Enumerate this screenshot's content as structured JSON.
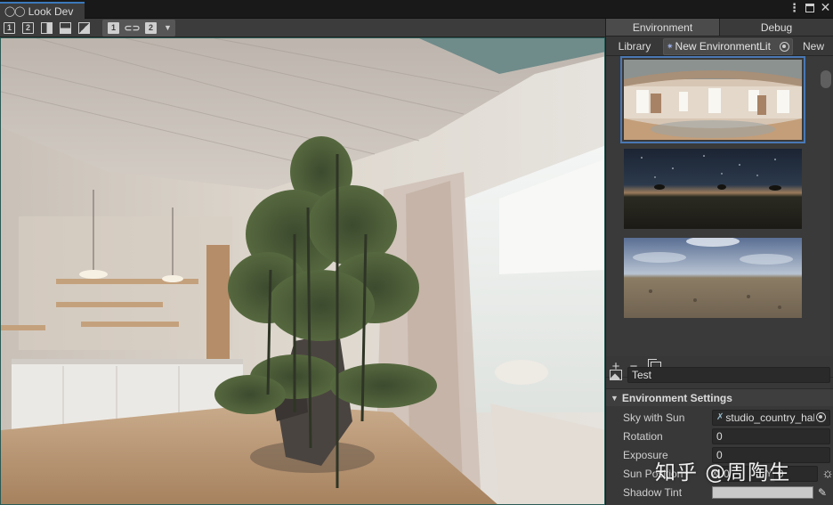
{
  "window": {
    "tab_title": "Look Dev",
    "controls": [
      "kebab-icon",
      "maximize-icon",
      "close-icon"
    ]
  },
  "toolbar": {
    "view_single_1": "1",
    "view_single_2": "2",
    "compare_1": "1",
    "compare_2": "2"
  },
  "side_panel": {
    "tabs": [
      {
        "label": "Environment",
        "active": true
      },
      {
        "label": "Debug",
        "active": false
      }
    ],
    "sub_tabs": {
      "library": "Library",
      "environment_library": "New EnvironmentLit",
      "new": "New"
    },
    "environments": [
      {
        "name": "studio_country_hall",
        "kind": "interior-hdri",
        "selected": true
      },
      {
        "name": "night_sky",
        "kind": "night-hdri",
        "selected": false
      },
      {
        "name": "overcast_field",
        "kind": "field-hdri",
        "selected": false
      }
    ],
    "list_tools": {
      "add": "+",
      "remove": "−"
    },
    "environment_name": "Test",
    "settings": {
      "title": "Environment Settings",
      "sky_with_sun_label": "Sky with Sun",
      "sky_with_sun_value": "studio_country_hall",
      "rotation_label": "Rotation",
      "rotation_value": "0",
      "exposure_label": "Exposure",
      "exposure_value": "0",
      "sun_position_label": "Sun Position",
      "sun_x_label": "X",
      "sun_x_value": "0",
      "sun_y_label": "Y",
      "sun_y_value": "0",
      "shadow_tint_label": "Shadow Tint",
      "shadow_tint_color": "#c9c9c9"
    }
  },
  "watermark": "知乎 @周陶生",
  "colors": {
    "accent": "#3a79bb",
    "panel": "#383838",
    "toolbar": "#3c3c3c"
  }
}
